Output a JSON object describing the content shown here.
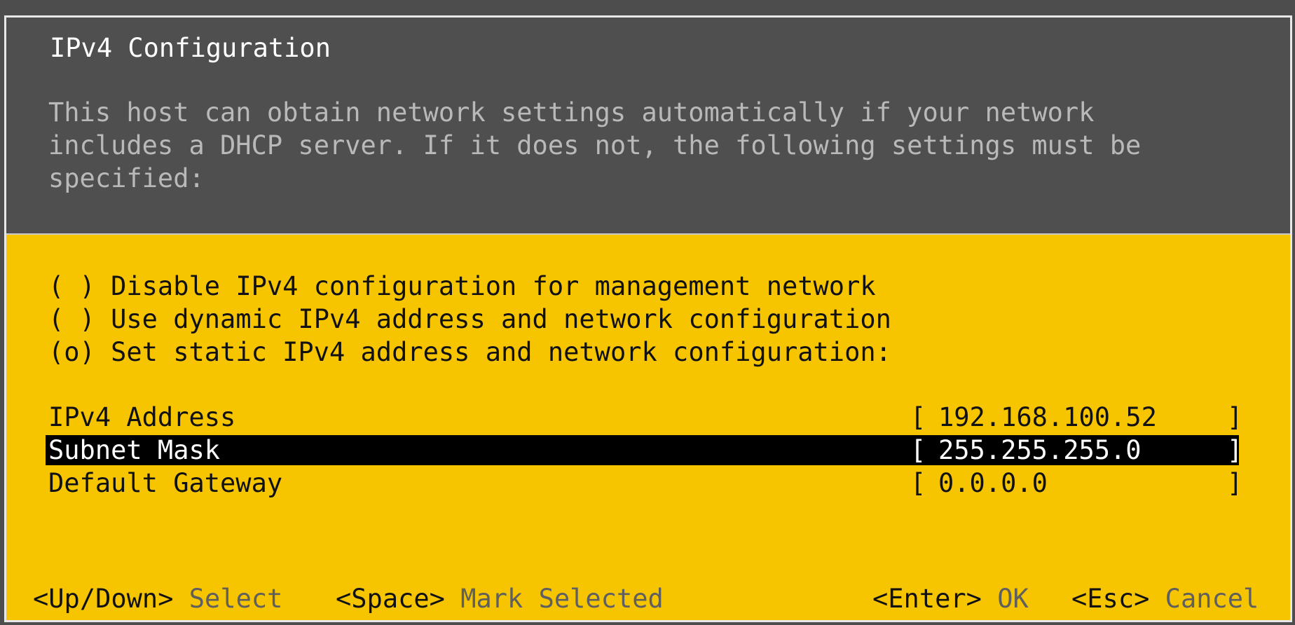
{
  "dialog": {
    "title": "IPv4 Configuration",
    "description_lines": [
      "This host can obtain network settings automatically if your network",
      "includes a DHCP server. If it does not, the following settings must be",
      "specified:"
    ]
  },
  "radio_options": [
    {
      "marker": "( )",
      "label": "Disable IPv4 configuration for management network",
      "selected": false
    },
    {
      "marker": "( )",
      "label": "Use dynamic IPv4 address and network configuration",
      "selected": false
    },
    {
      "marker": "(o)",
      "label": "Set static IPv4 address and network configuration:",
      "selected": true
    }
  ],
  "fields": [
    {
      "label": "IPv4 Address",
      "value": "192.168.100.52",
      "highlighted": false
    },
    {
      "label": "Subnet Mask",
      "value": "255.255.255.0",
      "highlighted": true
    },
    {
      "label": "Default Gateway",
      "value": "0.0.0.0",
      "highlighted": false
    }
  ],
  "bracket_open": "[",
  "bracket_close": "]",
  "footer": {
    "hints": [
      {
        "key": "<Up/Down>",
        "action": "Select"
      },
      {
        "key": "<Space>",
        "action": "Mark Selected"
      },
      {
        "key": "<Enter>",
        "action": "OK"
      },
      {
        "key": "<Esc>",
        "action": "Cancel"
      }
    ]
  },
  "colors": {
    "background": "#4d4d4d",
    "header": "#4f4f4f",
    "body": "#f6c500",
    "title_text": "#ffffff",
    "description_text": "#b9b9b9",
    "selection_bg": "#000000",
    "selection_text": "#ffffff",
    "hint_action_text": "#5f5f5f"
  }
}
